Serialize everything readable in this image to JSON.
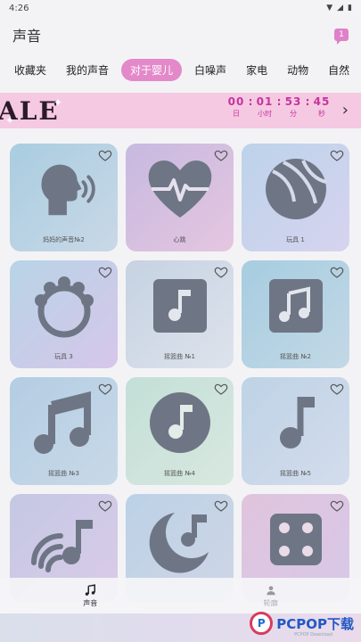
{
  "status": {
    "time": "4:26",
    "battery_icon": "battery-icon",
    "signal_icon": "signal-icon"
  },
  "header": {
    "title": "声音",
    "chat_badge": "1"
  },
  "tabs": [
    {
      "label": "收藏夹"
    },
    {
      "label": "我的声音"
    },
    {
      "label": "对于婴儿",
      "active": true
    },
    {
      "label": "白噪声"
    },
    {
      "label": "家电"
    },
    {
      "label": "动物"
    },
    {
      "label": "自然"
    }
  ],
  "banner": {
    "text": "ALE",
    "hours": "00",
    "minutes": "01",
    "seconds": "53",
    "frames": "45",
    "labels": [
      "日",
      "小时",
      "分",
      "秒"
    ]
  },
  "cards": [
    {
      "label": "妈妈的声音№2",
      "icon": "woman-speaking-icon"
    },
    {
      "label": "心跳",
      "icon": "heartbeat-icon"
    },
    {
      "label": "玩具 1",
      "icon": "ball-icon"
    },
    {
      "label": "玩具 3",
      "icon": "rattle-icon"
    },
    {
      "label": "摇篮曲 №1",
      "icon": "music-note-square-icon"
    },
    {
      "label": "摇篮曲 №2",
      "icon": "music-double-note-square-icon"
    },
    {
      "label": "摇篮曲 №3",
      "icon": "double-note-icon"
    },
    {
      "label": "摇篮曲 №4",
      "icon": "music-note-circle-icon"
    },
    {
      "label": "摇篮曲 №5",
      "icon": "single-note-icon"
    },
    {
      "label": "",
      "icon": "music-wave-icon"
    },
    {
      "label": "",
      "icon": "moon-note-icon"
    },
    {
      "label": "",
      "icon": "dice-icon"
    }
  ],
  "nav": [
    {
      "label": "声音",
      "icon": "music-note-icon",
      "active": true
    },
    {
      "label": "轮廓",
      "icon": "person-icon",
      "active": false
    }
  ],
  "watermark": {
    "text": "PCPOP下载",
    "sub": "PCPOP Download"
  }
}
